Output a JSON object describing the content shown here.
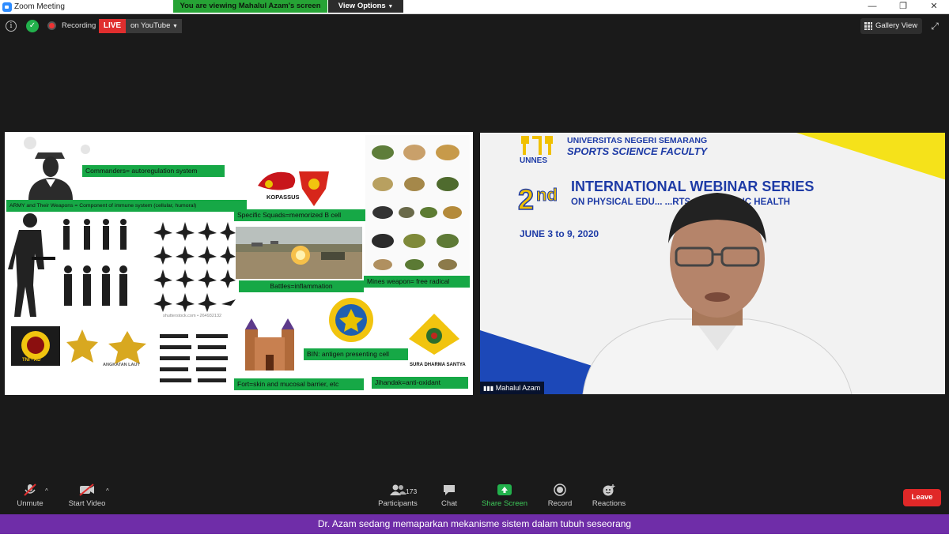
{
  "window": {
    "title": "Zoom Meeting",
    "minimize": "—",
    "maximize": "❐",
    "close": "✕"
  },
  "share_banner": {
    "viewing_text": "You are viewing Mahalul Azam's screen",
    "view_options": "View Options"
  },
  "meeting_bar": {
    "info_icon": "info-icon",
    "recording_label": "Recording",
    "live_label": "LIVE",
    "stream_target": "on YouTube",
    "gallery_view": "Gallery View"
  },
  "slide": {
    "labels": {
      "commanders": "Commanders= autoregulation system",
      "army": "ARMY and Their Weapons = Component of immune system (cellular, humoral)",
      "squads": "Specific Squads=memorized B cell",
      "battles": "Battles=inflammation",
      "mines": "Mines weapon= free radical",
      "bin": "BIN: antigen presenting cell",
      "fort": "Fort=skin and mucosal barrier, etc",
      "jihandak": "Jihandak=anti-oxidant"
    },
    "badges": {
      "kopassus": "KOPASSUS",
      "tni": "TNI - AD",
      "angkatan": "ANGKATAN LAUT",
      "sura": "SURA DHARMA SANTYA"
    },
    "watermark": "shutterstock.com • 264932132"
  },
  "speaker": {
    "university": "UNIVERSITAS NEGERI SEMARANG",
    "faculty": "SPORTS SCIENCE FACULTY",
    "unnes": "UNNES",
    "ordinal_number": "2",
    "ordinal_suffix": "nd",
    "webinar_title": "INTERNATIONAL WEBINAR SERIES",
    "webinar_subtitle": "ON PHYSICAL EDU...       ...RTS, AND PUBLIC HEALTH",
    "dates": "JUNE 3 to 9, 2020",
    "name": "Mahalul Azam"
  },
  "toolbar": {
    "unmute": "Unmute",
    "start_video": "Start Video",
    "participants": "Participants",
    "participant_count": "173",
    "chat": "Chat",
    "share_screen": "Share Screen",
    "record": "Record",
    "reactions": "Reactions",
    "leave": "Leave"
  },
  "caption": "Dr. Azam sedang memaparkan mekanisme sistem dalam tubuh seseorang",
  "colors": {
    "share_green": "#16a846",
    "live_red": "#e02e2e",
    "leave_red": "#e02828",
    "caption_purple": "#6f2da8",
    "webinar_blue": "#1e3ba6",
    "webinar_yellow": "#f5e21a"
  }
}
